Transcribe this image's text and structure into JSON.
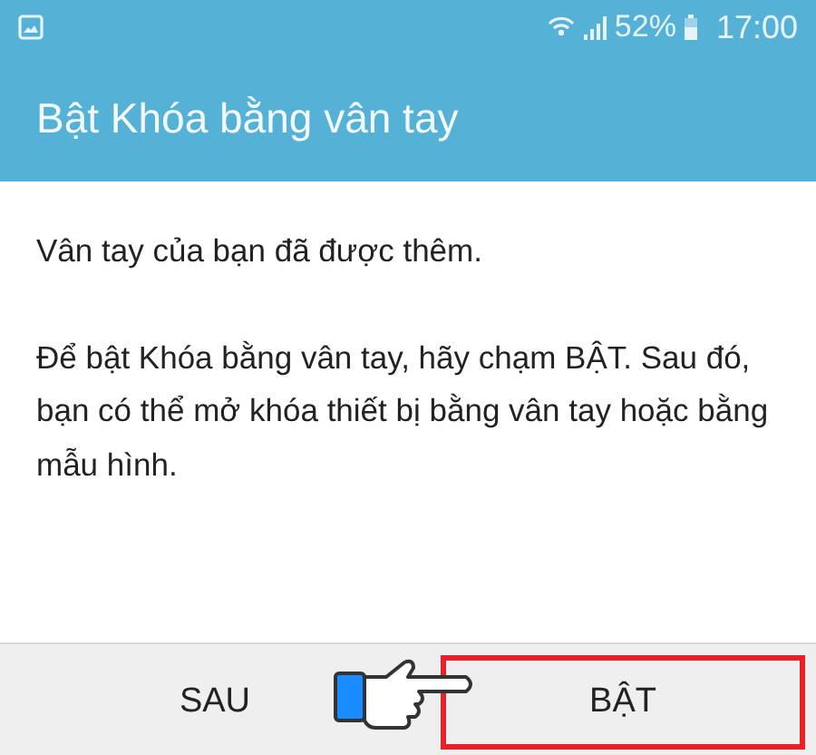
{
  "status_bar": {
    "battery": "52%",
    "time": "17:00"
  },
  "title": "Bật Khóa bằng vân tay",
  "paragraphs": [
    "Vân tay của bạn đã được thêm.",
    "Để bật Khóa bằng vân tay, hãy chạm BẬT. Sau đó, bạn có thể mở khóa thiết bị bằng vân tay hoặc bằng mẫu hình."
  ],
  "buttons": [
    {
      "label": "SAU",
      "highlighted": false
    },
    {
      "label": "BẬT",
      "highlighted": true
    }
  ]
}
